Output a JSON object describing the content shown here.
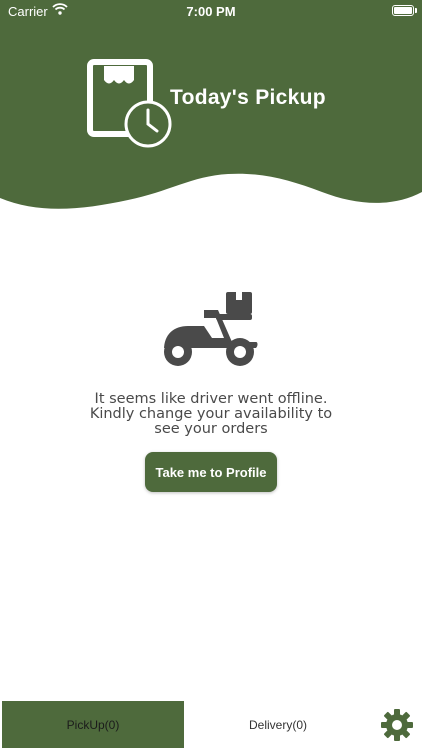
{
  "status_bar": {
    "carrier": "Carrier",
    "time": "7:00 PM"
  },
  "header": {
    "title": "Today's Pickup",
    "logo_icon": "store-clock-icon"
  },
  "colors": {
    "primary": "#4e6a3c",
    "text": "#4a4a4a",
    "background": "#ffffff"
  },
  "empty_state": {
    "icon": "delivery-scooter-icon",
    "message_lines": [
      "It seems like driver went offline.",
      "Kindly change your availability to",
      "see your orders"
    ],
    "button_label": "Take me to Profile"
  },
  "tabbar": {
    "pickup_label": "PickUp(0)",
    "delivery_label": "Delivery(0)",
    "settings_icon": "gear-icon"
  }
}
